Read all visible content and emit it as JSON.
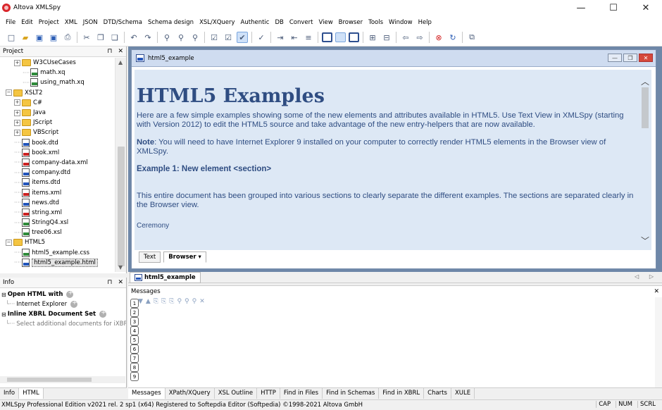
{
  "window": {
    "title": "Altova XMLSpy",
    "minimize": "—",
    "maximize": "☐",
    "close": "✕"
  },
  "menu": [
    "File",
    "Edit",
    "Project",
    "XML",
    "JSON",
    "DTD/Schema",
    "Schema design",
    "XSL/XQuery",
    "Authentic",
    "DB",
    "Convert",
    "View",
    "Browser",
    "Tools",
    "Window",
    "Help"
  ],
  "toolbar": {
    "icons": [
      "new-icon",
      "open-icon",
      "save-icon",
      "save-all-icon",
      "print-icon",
      "cut-icon",
      "copy-icon",
      "paste-icon",
      "undo-icon",
      "redo-icon",
      "find-icon",
      "find-next-icon",
      "replace-icon",
      "validate-icon",
      "check-wellformed-icon",
      "schema-check-icon",
      "spellcheck-icon",
      "indent-icon",
      "outdent-icon",
      "comment-icon",
      "text-view-icon",
      "grid-view-icon",
      "schema-view-icon",
      "xslt-icon",
      "xquery-icon",
      "back-icon",
      "forward-icon",
      "stop-icon",
      "refresh-icon",
      "window-icon"
    ]
  },
  "project": {
    "title": "Project",
    "pin": "⊓",
    "close": "✕",
    "items": [
      {
        "label": "W3CUseCases",
        "type": "folder",
        "indent": 1,
        "expander": "+"
      },
      {
        "label": "math.xq",
        "type": "file",
        "indent": 2,
        "color": "green"
      },
      {
        "label": "using_math.xq",
        "type": "file",
        "indent": 2,
        "color": "green"
      },
      {
        "label": "XSLT2",
        "type": "folder",
        "indent": 0,
        "expander": "−"
      },
      {
        "label": "C#",
        "type": "folder",
        "indent": 1,
        "expander": "+"
      },
      {
        "label": "Java",
        "type": "folder",
        "indent": 1,
        "expander": "+"
      },
      {
        "label": "JScript",
        "type": "folder",
        "indent": 1,
        "expander": "+"
      },
      {
        "label": "VBScript",
        "type": "folder",
        "indent": 1,
        "expander": "+"
      },
      {
        "label": "book.dtd",
        "type": "file",
        "indent": 1,
        "color": "blue"
      },
      {
        "label": "book.xml",
        "type": "file",
        "indent": 1,
        "color": "red"
      },
      {
        "label": "company-data.xml",
        "type": "file",
        "indent": 1,
        "color": "red"
      },
      {
        "label": "company.dtd",
        "type": "file",
        "indent": 1,
        "color": "blue"
      },
      {
        "label": "items.dtd",
        "type": "file",
        "indent": 1,
        "color": "blue"
      },
      {
        "label": "items.xml",
        "type": "file",
        "indent": 1,
        "color": "red"
      },
      {
        "label": "news.dtd",
        "type": "file",
        "indent": 1,
        "color": "blue"
      },
      {
        "label": "string.xml",
        "type": "file",
        "indent": 1,
        "color": "red"
      },
      {
        "label": "StringQ4.xsl",
        "type": "file",
        "indent": 1,
        "color": "green"
      },
      {
        "label": "tree06.xsl",
        "type": "file",
        "indent": 1,
        "color": "green"
      },
      {
        "label": "HTML5",
        "type": "folder",
        "indent": 0,
        "expander": "−"
      },
      {
        "label": "html5_example.css",
        "type": "file",
        "indent": 1,
        "color": "green"
      },
      {
        "label": "html5_example.html",
        "type": "file",
        "indent": 1,
        "color": "blue",
        "selected": true
      }
    ]
  },
  "info": {
    "title": "Info",
    "pin": "⊓",
    "close": "✕",
    "open_html_with": "Open HTML with",
    "internet_explorer": "Internet Explorer",
    "inline_xbrl": "Inline XBRL Document Set",
    "select_additional": "Select additional documents for iXBRL"
  },
  "left_tabs": [
    "Info",
    "HTML"
  ],
  "document": {
    "window_title": "html5_example",
    "heading": "HTML5 Examples",
    "intro": "Here are a few simple examples showing some of the new elements and attributes available in HTML5. Use Text View in XMLSpy (starting with Version 2012) to edit the HTML5 source and take advantage of the new entry-helpers that are now available.",
    "note_label": "Note",
    "note_text": ": You will need to have Internet Explorer 9 installed on your computer to correctly render HTML5 elements in the Browser view of XMLSpy.",
    "example1": "Example 1: New element <section>",
    "example1_text": "This entire document has been grouped into various sections to clearly separate the different examples. The sections are separated clearly in the Browser view.",
    "ceremony": "Ceremony",
    "view_tabs": {
      "text": "Text",
      "browser": "Browser ▾"
    }
  },
  "doc_tab": {
    "label": "html5_example",
    "nav": "◁ ▷"
  },
  "messages": {
    "title": "Messages",
    "close": "✕",
    "side_numbers": [
      "1",
      "2",
      "3",
      "4",
      "5",
      "6",
      "7",
      "8",
      "9"
    ]
  },
  "message_tabs": [
    "Messages",
    "XPath/XQuery",
    "XSL Outline",
    "HTTP",
    "Find in Files",
    "Find in Schemas",
    "Find in XBRL",
    "Charts",
    "XULE"
  ],
  "status": {
    "text": "XMLSpy Professional Edition v2021 rel. 2 sp1 (x64)   Registered to Softepdia Editor (Softpedia)   ©1998-2021 Altova GmbH",
    "cap": "CAP",
    "num": "NUM",
    "scrl": "SCRL"
  }
}
